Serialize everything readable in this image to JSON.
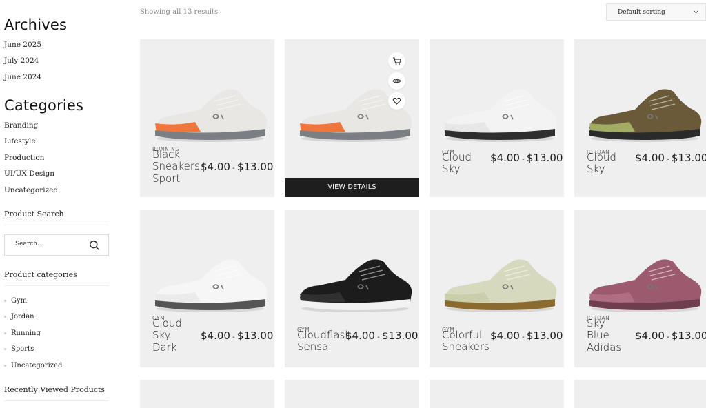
{
  "sidebar": {
    "archives": {
      "title": "Archives",
      "items": [
        "June 2025",
        "July 2024",
        "June 2024"
      ]
    },
    "categories": {
      "title": "Categories",
      "items": [
        "Branding",
        "Lifestyle",
        "Production",
        "UI/UX Design",
        "Uncategorized"
      ]
    },
    "product_search": {
      "title": "Product Search",
      "placeholder": "Search..."
    },
    "product_categories": {
      "title": "Product categories",
      "items": [
        "Gym",
        "Jordan",
        "Running",
        "Sports",
        "Uncategorized"
      ]
    },
    "recently_viewed": {
      "title": "Recently Viewed Products"
    }
  },
  "toolbar": {
    "result_count": "Showing all 13 results",
    "sort_value": "Default sorting"
  },
  "hover_card": {
    "view_details": "VIEW DETAILS",
    "actions": [
      "cart-icon",
      "eye-icon",
      "heart-icon"
    ]
  },
  "products": [
    {
      "category": "RUNNING",
      "name": [
        "Black",
        "Sneakers",
        "Sport"
      ],
      "price_low": "$4.00",
      "price_high": "$13.00",
      "shoe_color": "#e9e7e4",
      "accent": "#f06a2a",
      "sole": "#7b7f84"
    },
    {
      "category": "",
      "name": [],
      "price_low": "",
      "price_high": "",
      "shoe_color": "#e9e7e4",
      "accent": "#f06a2a",
      "sole": "#7b7f84"
    },
    {
      "category": "GYM",
      "name": [
        "Cloud",
        "Sky"
      ],
      "price_low": "$4.00",
      "price_high": "$13.00",
      "shoe_color": "#f3f3f3",
      "accent": "#e6e6e6",
      "sole": "#2e2e2e"
    },
    {
      "category": "JORDAN",
      "name": [
        "Cloud",
        "Sky"
      ],
      "price_low": "$4.00",
      "price_high": "$13.00",
      "shoe_color": "#6a5a3a",
      "accent": "#a8b56a",
      "sole": "#2a2a2a"
    },
    {
      "category": "GYM",
      "name": [
        "Cloud",
        "Sky",
        "Dark"
      ],
      "price_low": "$4.00",
      "price_high": "$13.00",
      "shoe_color": "#f6f6f6",
      "accent": "#eaeaea",
      "sole": "#555555"
    },
    {
      "category": "GYM",
      "name": [
        "Cloudflash",
        "Sensa"
      ],
      "price_low": "$4.00",
      "price_high": "$13.00",
      "shoe_color": "#1c1c1c",
      "accent": "#333333",
      "sole": "#f2f2f2"
    },
    {
      "category": "GYM",
      "name": [
        "Colorful",
        "Sneakers"
      ],
      "price_low": "$4.00",
      "price_high": "$13.00",
      "shoe_color": "#d7d9be",
      "accent": "#c9cca8",
      "sole": "#8a6a2e"
    },
    {
      "category": "JORDAN",
      "name": [
        "Sky",
        "Blue",
        "Adidas"
      ],
      "price_low": "$4.00",
      "price_high": "$13.00",
      "shoe_color": "#9c5a6e",
      "accent": "#b37084",
      "sole": "#6e3e4e"
    }
  ]
}
